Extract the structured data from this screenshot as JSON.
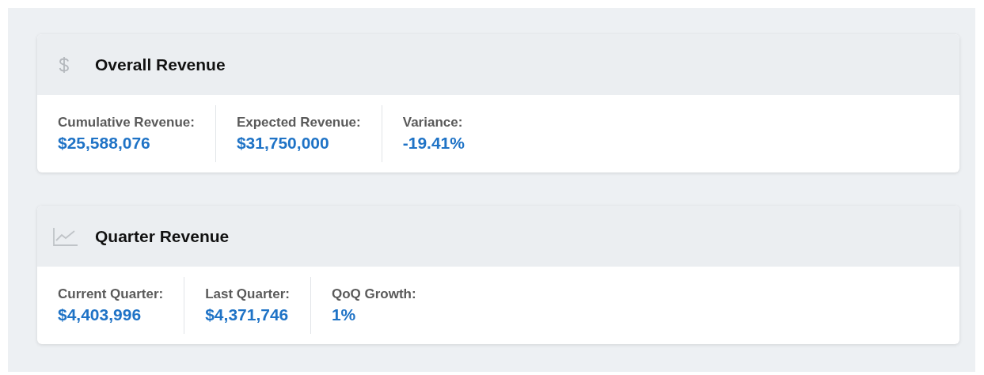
{
  "cards": [
    {
      "title": "Overall Revenue",
      "kind": "dollar",
      "metrics": [
        {
          "label": "Cumulative Revenue:",
          "value": "$25,588,076"
        },
        {
          "label": "Expected Revenue:",
          "value": "$31,750,000"
        },
        {
          "label": "Variance:",
          "value": "-19.41%"
        }
      ]
    },
    {
      "title": "Quarter Revenue",
      "kind": "chart",
      "metrics": [
        {
          "label": "Current Quarter:",
          "value": "$4,403,996"
        },
        {
          "label": "Last Quarter:",
          "value": "$4,371,746"
        },
        {
          "label": "QoQ Growth:",
          "value": "1%"
        }
      ]
    }
  ]
}
